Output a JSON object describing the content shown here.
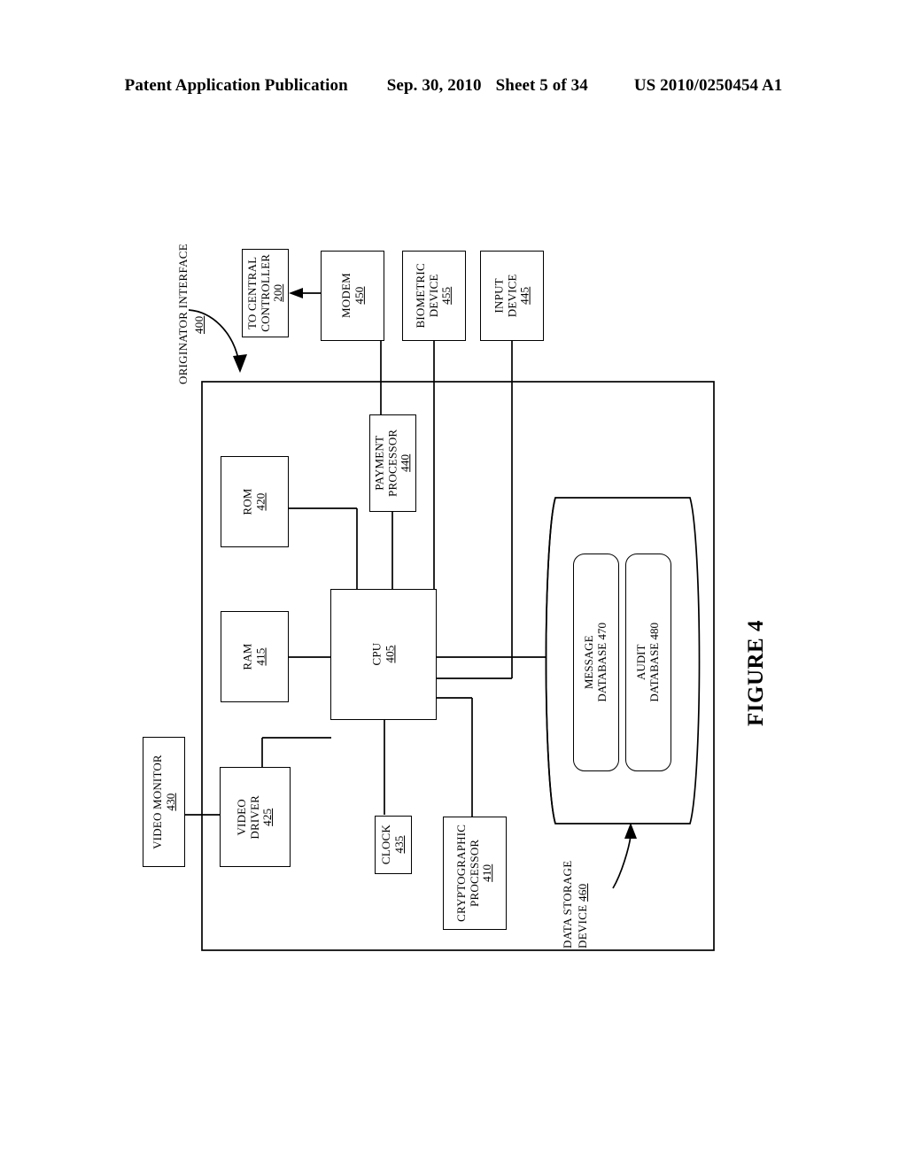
{
  "header": {
    "publication": "Patent Application Publication",
    "date": "Sep. 30, 2010",
    "sheet": "Sheet 5 of 34",
    "patent_number": "US 2010/0250454 A1"
  },
  "figure": {
    "caption": "FIGURE 4",
    "system_label": {
      "name": "ORIGINATOR  INTERFACE",
      "ref": "400"
    },
    "storage_label": {
      "line1": "DATA STORAGE",
      "line2": "DEVICE",
      "ref": "460"
    },
    "nodes": {
      "central_controller": {
        "line1": "TO CENTRAL",
        "line2": "CONTROLLER",
        "ref": "200"
      },
      "modem": {
        "line1": "MODEM",
        "ref": "450"
      },
      "biometric_device": {
        "line1": "BIOMETRIC",
        "line2": "DEVICE",
        "ref": "455"
      },
      "input_device": {
        "line1": "INPUT",
        "line2": "DEVICE",
        "ref": "445"
      },
      "payment_processor": {
        "line1": "PAYMENT",
        "line2": "PROCESSOR",
        "ref": "440"
      },
      "rom": {
        "line1": "ROM",
        "ref": "420"
      },
      "ram": {
        "line1": "RAM",
        "ref": "415"
      },
      "cpu": {
        "line1": "CPU",
        "ref": "405"
      },
      "video_monitor": {
        "line1": "VIDEO MONITOR",
        "ref": "430"
      },
      "video_driver": {
        "line1": "VIDEO",
        "line2": "DRIVER",
        "ref": "425"
      },
      "clock": {
        "line1": "CLOCK",
        "ref": "435"
      },
      "cryptographic_processor": {
        "line1": "CRYPTOGRAPHIC",
        "line2": "PROCESSOR",
        "ref": "410"
      },
      "message_database": {
        "line1": "MESSAGE",
        "line2": "DATABASE",
        "ref": "470"
      },
      "audit_database": {
        "line1": "AUDIT",
        "line2": "DATABASE",
        "ref": "480"
      }
    }
  },
  "colors": {
    "ink": "#000000",
    "paper": "#ffffff"
  }
}
